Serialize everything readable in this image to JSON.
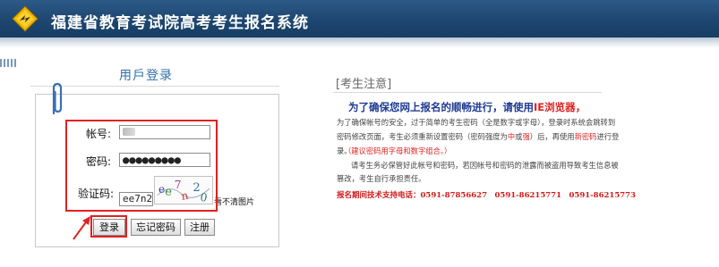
{
  "header": {
    "title": "福建省教育考试院高考考生报名系统",
    "colors": {
      "bar": "#1d4670",
      "text": "#ffffff"
    }
  },
  "login": {
    "title": "用戶登录",
    "username_label": "帐号:",
    "password_label": "密码:",
    "password_value": "●●●●●●●●●",
    "captcha_label": "验证码:",
    "captcha_value": "ee7n20",
    "captcha_image_text": "ee7n20",
    "captcha_hint": "看不清图片",
    "buttons": {
      "login": "登录",
      "forgot": "忘记密码",
      "register": "注册"
    },
    "highlight_color": "#e02121"
  },
  "notice": {
    "title": "[考生注意]",
    "line1_prefix": "为了确保您网上报名的顺畅进行，请使用",
    "line1_ie": "IE浏览器",
    "line1_suffix": "，",
    "p1_line1": "为了确保帐号的安全，过于简单的考生密码（全是数字或字母），登录时系统会跳转到",
    "p1_line2_a": "密码修改页面，考生必须重新设置密码（密码强度为",
    "p1_line2_mid": "中",
    "p1_line2_b": "或",
    "p1_line2_strong": "强",
    "p1_line2_c": "）后，再使用",
    "p1_line2_new": "新密码",
    "p1_line2_d": "进行登",
    "p1_line3": "录。",
    "p1_red": "（建议密码用字母和数字组合。）",
    "p2_line1": "请考生务必保管好此帐号和密码，若因帐号和密码的泄露而被盗用导致考生信息被",
    "p2_line2": "篡改，考生自行承担责任。",
    "hotline": "报名期间技术支持电话：0591-87856627　0591-86215771　0591-86215773"
  }
}
